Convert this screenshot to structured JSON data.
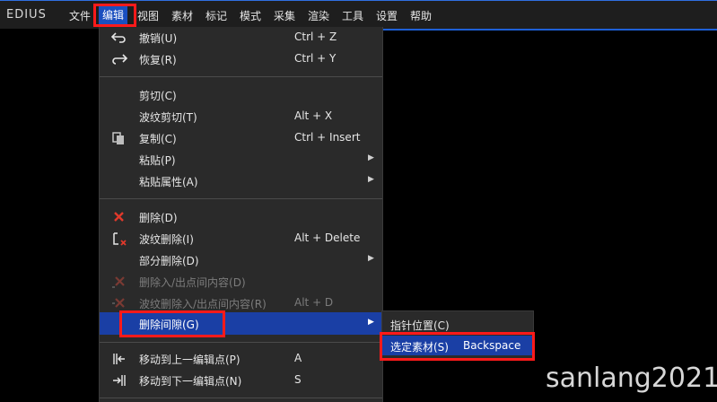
{
  "app": {
    "logo": "EDIUS"
  },
  "menubar": {
    "items": [
      "文件",
      "编辑",
      "视图",
      "素材",
      "标记",
      "模式",
      "采集",
      "渲染",
      "工具",
      "设置",
      "帮助"
    ]
  },
  "edit_menu": {
    "items": [
      {
        "label": "撤销(U)",
        "shortcut": "Ctrl + Z",
        "icon": "undo-icon"
      },
      {
        "label": "恢复(R)",
        "shortcut": "Ctrl + Y",
        "icon": "redo-icon"
      },
      {
        "label": "剪切(C)",
        "shortcut": ""
      },
      {
        "label": "波纹剪切(T)",
        "shortcut": "Alt + X"
      },
      {
        "label": "复制(C)",
        "shortcut": "Ctrl + Insert",
        "icon": "copy-icon"
      },
      {
        "label": "粘贴(P)",
        "submenu": true
      },
      {
        "label": "粘贴属性(A)",
        "submenu": true
      },
      {
        "label": "删除(D)",
        "icon": "delete-x-icon"
      },
      {
        "label": "波纹删除(I)",
        "shortcut": "Alt + Delete",
        "icon": "ripple-delete-icon"
      },
      {
        "label": "部分删除(D)",
        "submenu": true
      },
      {
        "label": "删除入/出点间内容(D)",
        "disabled": true,
        "icon": "delete-inout-icon"
      },
      {
        "label": "波纹删除入/出点间内容(R)",
        "shortcut": "Alt + D",
        "disabled": true,
        "icon": "ripple-delete-inout-icon"
      },
      {
        "label": "删除间隙(G)",
        "submenu": true,
        "selected": true
      },
      {
        "label": "移动到上一编辑点(P)",
        "shortcut": "A",
        "icon": "prev-edit-point-icon"
      },
      {
        "label": "移动到下一编辑点(N)",
        "shortcut": "S",
        "icon": "next-edit-point-icon"
      }
    ]
  },
  "submenu_delete_gap": {
    "items": [
      {
        "label": "指针位置(C)",
        "shortcut": ""
      },
      {
        "label": "选定素材(S)",
        "shortcut": "Backspace",
        "selected": true
      }
    ]
  },
  "colors": {
    "accent": "#1a3fa5",
    "highlight_box": "#ff1a1a",
    "menu_bg": "#2a2a2a"
  },
  "watermark": "sanlang2021"
}
